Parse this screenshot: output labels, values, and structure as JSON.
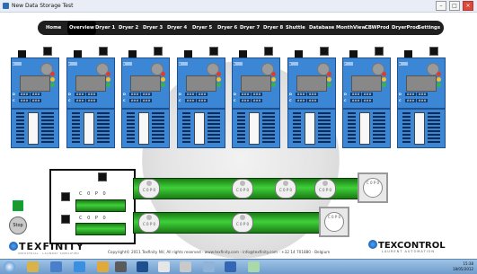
{
  "window": {
    "title": "New Data Storage Test",
    "controls": {
      "minimize": "–",
      "maximize": "□",
      "close": "×"
    }
  },
  "nav": {
    "items": [
      "Home",
      "Overview",
      "Dryer 1",
      "Dryer 2",
      "Dryer 3",
      "Dryer 4",
      "Dryer 5",
      "Dryer 6",
      "Dryer 7",
      "Dryer 8",
      "Shuttle",
      "Database",
      "MonthView",
      "CBWProd",
      "DryerProd",
      "Settings"
    ],
    "active": "Overview"
  },
  "dryers": [
    {
      "number": "1"
    },
    {
      "number": "2"
    },
    {
      "number": "3"
    },
    {
      "number": "4"
    },
    {
      "number": "5"
    },
    {
      "number": "6"
    },
    {
      "number": "7"
    },
    {
      "number": "8"
    }
  ],
  "dryer_fields": {
    "d_label": "D",
    "c_label": "C",
    "val_a": "###",
    "val_b": "###"
  },
  "shuttle": {
    "row_text": "C 0  P 0",
    "slot_text": "C 0\nP 0"
  },
  "controls": {
    "stop_label": "Stop"
  },
  "footer": {
    "left_logo": "TEXFINITY",
    "left_logo_sub": "INDUSTRIAL · LAUNDRY SIMPLIFIED",
    "copyright": "Copyright© 2011 Texfinity NV, All rights reserved - www.texfinity.com - info@texfinity.com - +32 14 701880 - Belgium",
    "right_logo": "TEXCONTROL",
    "right_logo_sub": "LAURENT AUTOMATION"
  },
  "taskbar": {
    "time": "15:38",
    "date": "18/05/2012"
  },
  "colors": {
    "dryer_blue": "#3c86d6",
    "conveyor_green": "#3fd03a",
    "nav_bg": "#1f1f1f"
  }
}
